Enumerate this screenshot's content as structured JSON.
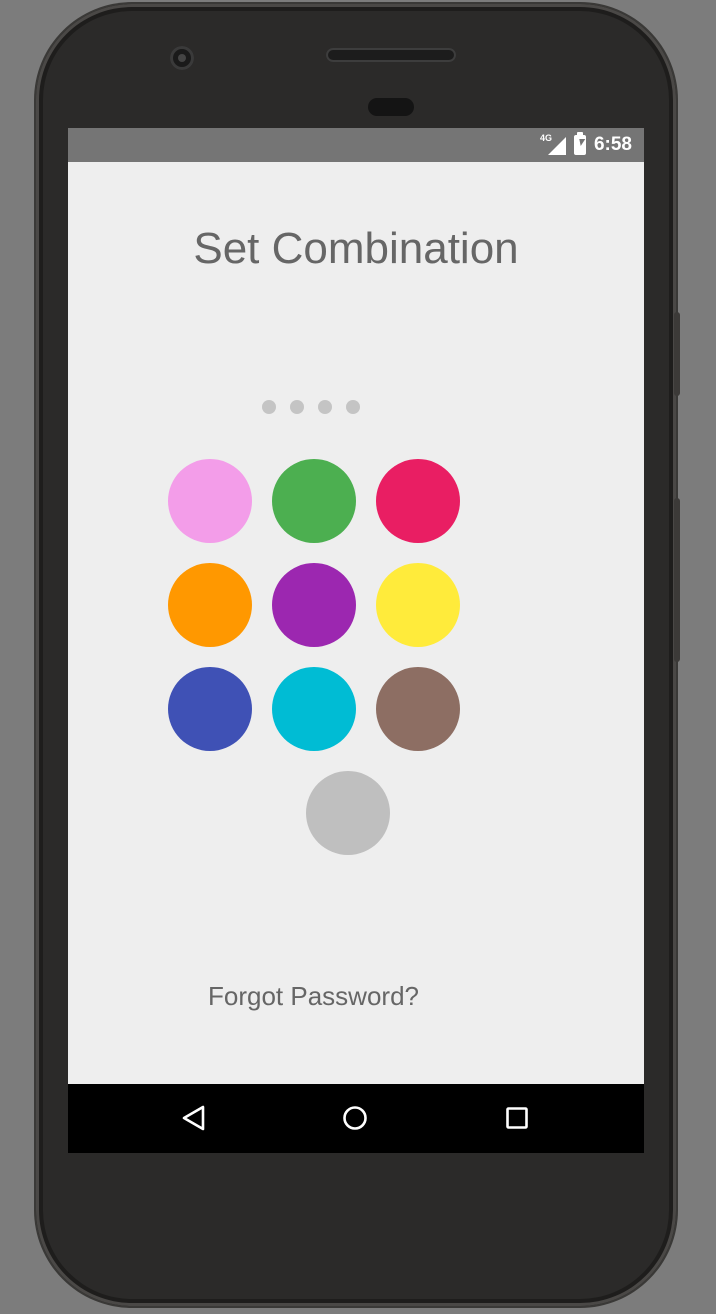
{
  "status_bar": {
    "network_type": "4G",
    "time": "6:58",
    "icons": [
      "signal-icon",
      "battery-charging-icon"
    ],
    "background_color": "#757575"
  },
  "screen": {
    "title": "Set Combination",
    "entered_digits": 0,
    "combination_length": 4,
    "color_buttons": [
      {
        "name": "pink",
        "color": "#f39de9"
      },
      {
        "name": "green",
        "color": "#4caf50"
      },
      {
        "name": "crimson",
        "color": "#e91e63"
      },
      {
        "name": "orange",
        "color": "#ff9800"
      },
      {
        "name": "purple",
        "color": "#9c27b0"
      },
      {
        "name": "yellow",
        "color": "#ffeb3b"
      },
      {
        "name": "indigo",
        "color": "#3f51b5"
      },
      {
        "name": "cyan",
        "color": "#00bcd4"
      },
      {
        "name": "brown",
        "color": "#8d6e63"
      }
    ],
    "extra_button_color": "#bfbfbf",
    "forgot_link": "Forgot Password?",
    "background_color": "#eeeeee"
  },
  "nav_bar": {
    "buttons": [
      "back-icon",
      "home-icon",
      "recents-icon"
    ]
  }
}
